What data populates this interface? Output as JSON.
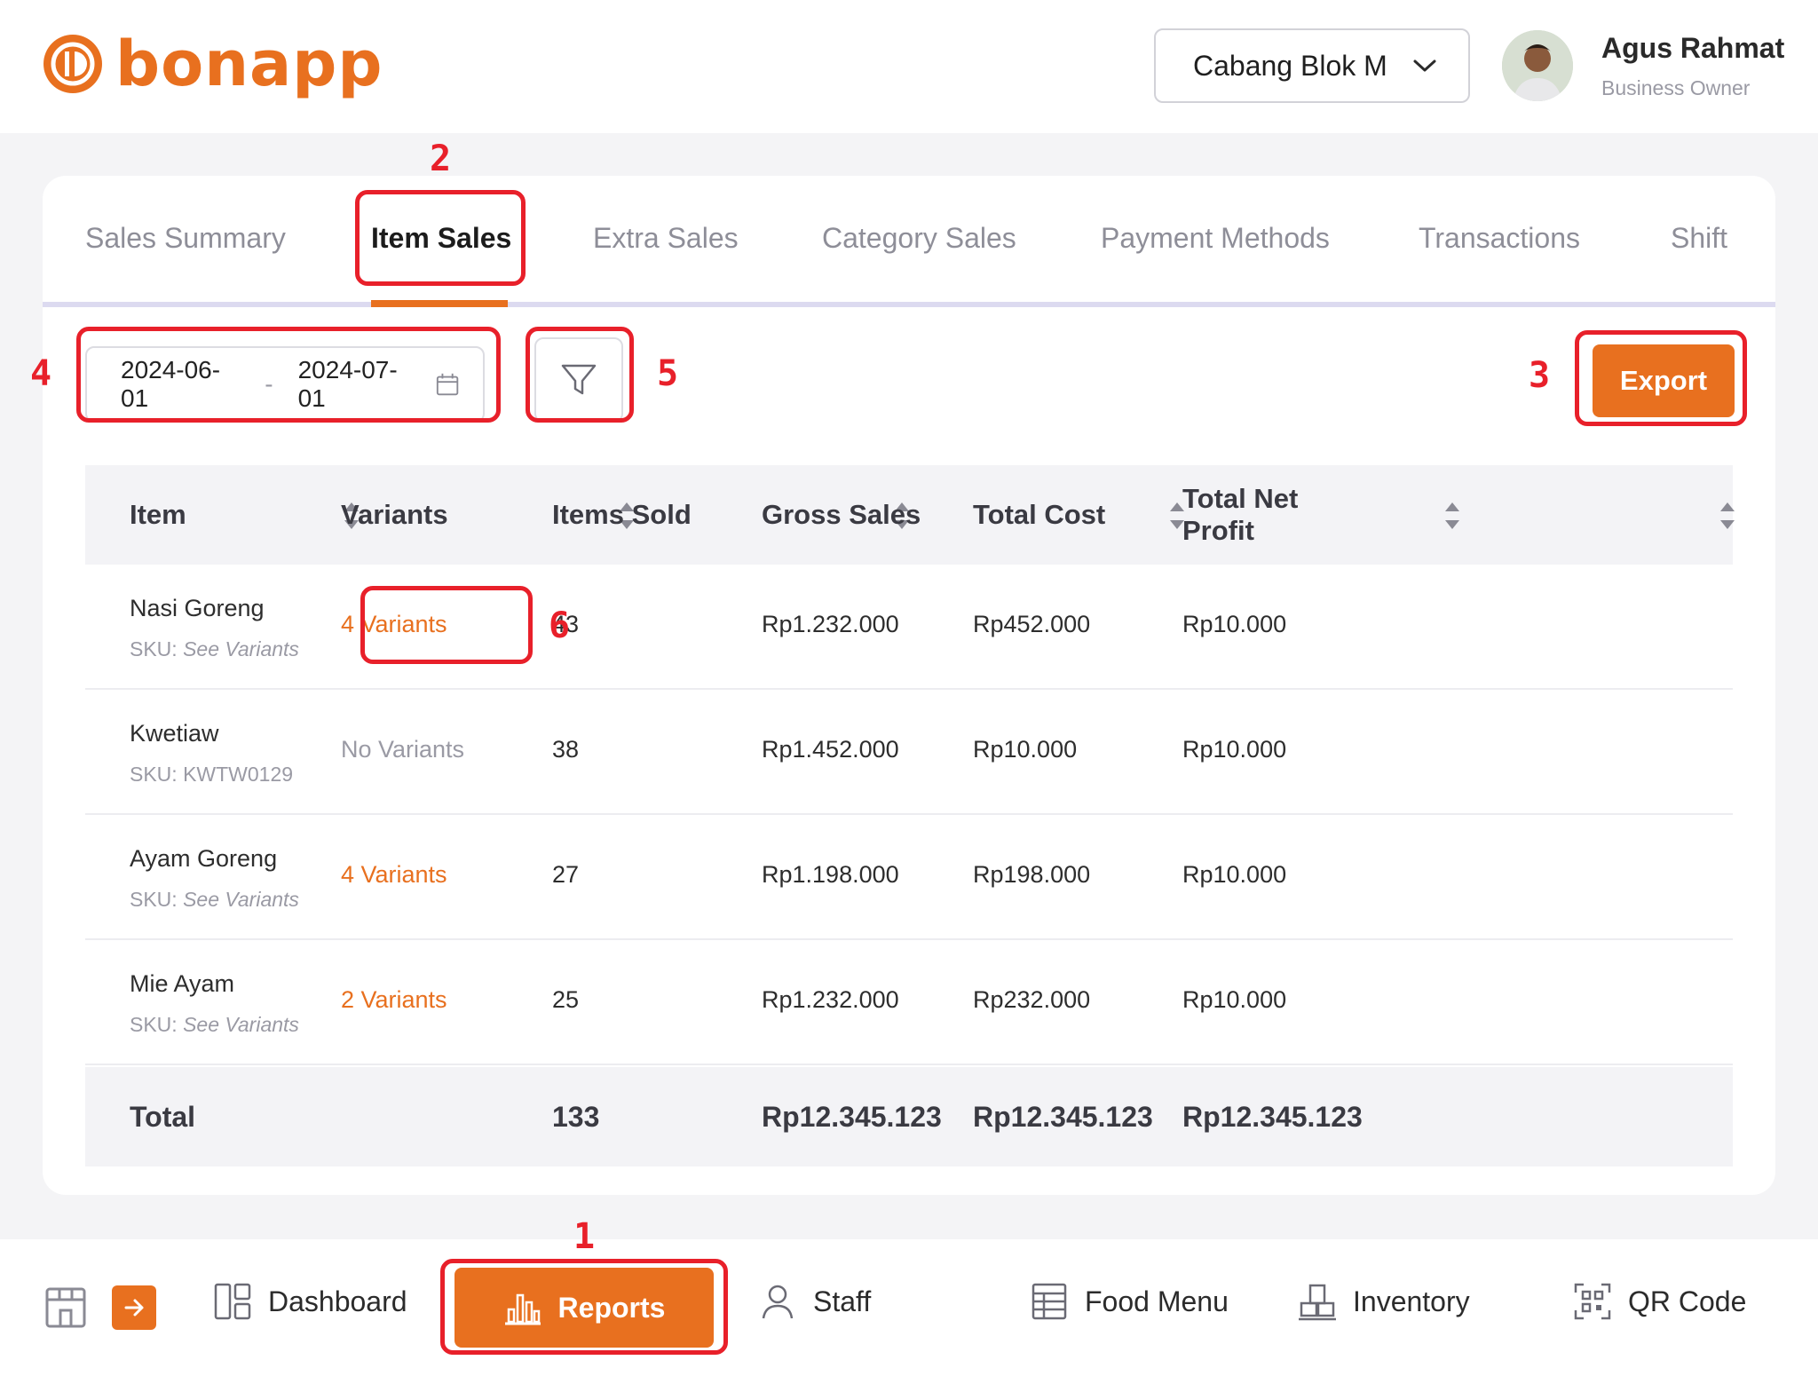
{
  "app": {
    "logo_text": "bonapp",
    "brand_color": "#e8701f",
    "branch_selector": {
      "label": "Cabang Blok M",
      "icon": "chevron-down-icon"
    },
    "user": {
      "name": "Agus Rahmat",
      "role": "Business Owner"
    }
  },
  "tabs": [
    {
      "label": "Sales Summary",
      "active": false
    },
    {
      "label": "Item Sales",
      "active": true
    },
    {
      "label": "Extra Sales",
      "active": false
    },
    {
      "label": "Category Sales",
      "active": false
    },
    {
      "label": "Payment Methods",
      "active": false
    },
    {
      "label": "Transactions",
      "active": false
    },
    {
      "label": "Shift",
      "active": false
    }
  ],
  "toolbar": {
    "date_start": "2024-06-01",
    "date_sep": "-",
    "date_end": "2024-07-01",
    "date_icon": "calendar-icon",
    "filter_icon": "filter-icon",
    "export_label": "Export"
  },
  "table": {
    "headers": [
      "Item",
      "Variants",
      "Items Sold",
      "Gross Sales",
      "Total Cost",
      "Total Net Profit"
    ],
    "rows": [
      {
        "item": "Nasi Goreng",
        "sku_prefix": "SKU:",
        "sku": "See Variants",
        "sku_italic": true,
        "variants": "4 Variants",
        "has_variants": true,
        "items_sold": "43",
        "gross_sales": "Rp1.232.000",
        "total_cost": "Rp452.000",
        "net_profit": "Rp10.000"
      },
      {
        "item": "Kwetiaw",
        "sku_prefix": "SKU:",
        "sku": "KWTW0129",
        "sku_italic": false,
        "variants": "No Variants",
        "has_variants": false,
        "items_sold": "38",
        "gross_sales": "Rp1.452.000",
        "total_cost": "Rp10.000",
        "net_profit": "Rp10.000"
      },
      {
        "item": "Ayam Goreng",
        "sku_prefix": "SKU:",
        "sku": "See Variants",
        "sku_italic": true,
        "variants": "4 Variants",
        "has_variants": true,
        "items_sold": "27",
        "gross_sales": "Rp1.198.000",
        "total_cost": "Rp198.000",
        "net_profit": "Rp10.000"
      },
      {
        "item": "Mie Ayam",
        "sku_prefix": "SKU:",
        "sku": "See Variants",
        "sku_italic": true,
        "variants": "2 Variants",
        "has_variants": true,
        "items_sold": "25",
        "gross_sales": "Rp1.232.000",
        "total_cost": "Rp232.000",
        "net_profit": "Rp10.000"
      }
    ],
    "total": {
      "label": "Total",
      "items_sold": "133",
      "gross_sales": "Rp12.345.123",
      "total_cost": "Rp12.345.123",
      "net_profit": "Rp12.345.123"
    }
  },
  "bottom_nav": [
    {
      "label": "Dashboard",
      "icon": "dashboard-icon",
      "active": false
    },
    {
      "label": "Reports",
      "icon": "bar-chart-icon",
      "active": true
    },
    {
      "label": "Staff",
      "icon": "user-icon",
      "active": false
    },
    {
      "label": "Food Menu",
      "icon": "menu-icon",
      "active": false
    },
    {
      "label": "Inventory",
      "icon": "boxes-icon",
      "active": false
    },
    {
      "label": "QR Code",
      "icon": "qr-code-icon",
      "active": false
    }
  ],
  "annotations": [
    "1",
    "2",
    "3",
    "4",
    "5",
    "6"
  ],
  "annotation_color": "#e8202a"
}
